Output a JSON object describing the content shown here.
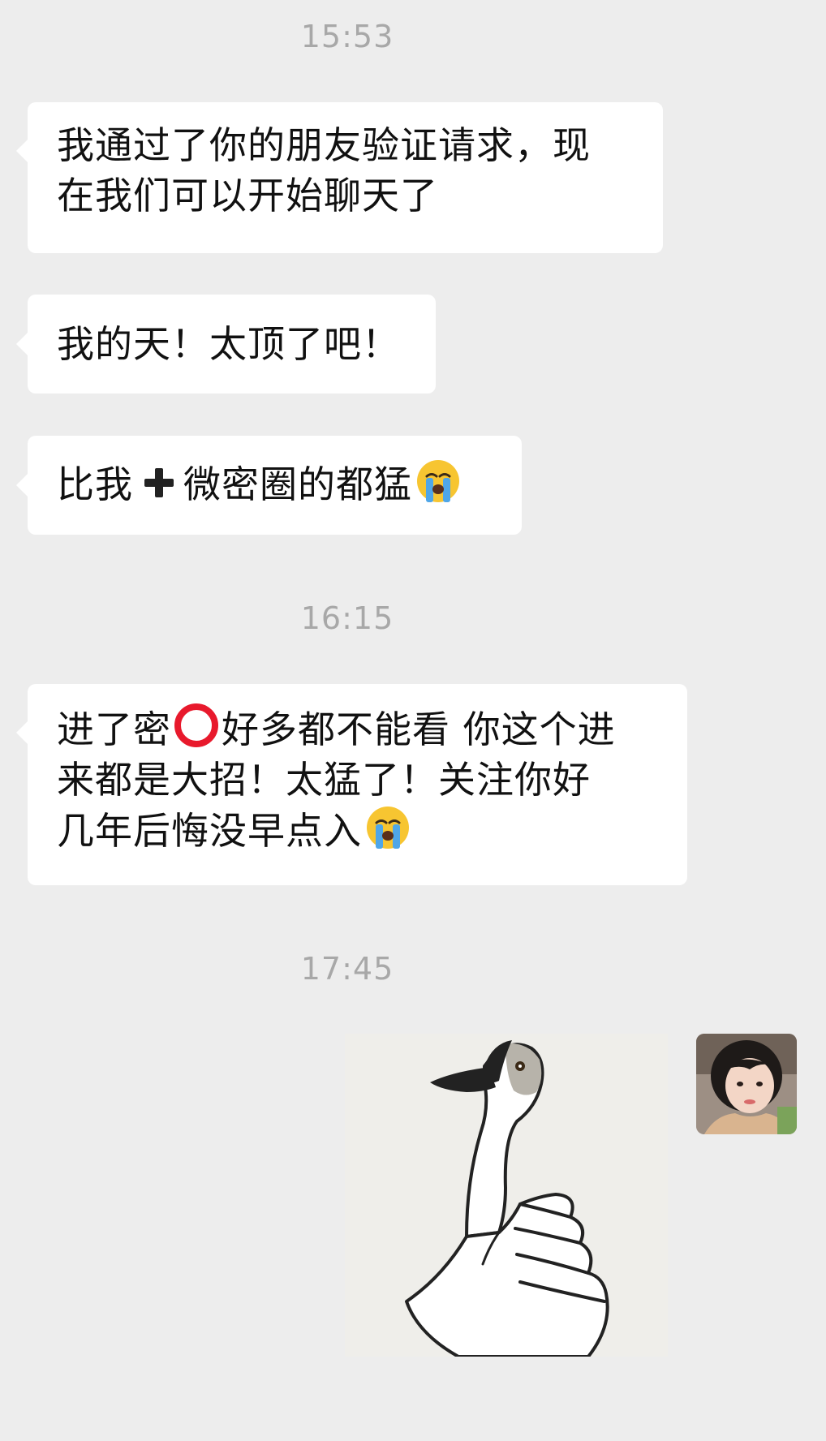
{
  "chat": {
    "timestamps": [
      "15:53",
      "16:15",
      "17:45"
    ],
    "messages": {
      "m1": {
        "line1": "我通过了你的朋友验证请求，现",
        "line2": "在我们可以开始聊天了"
      },
      "m2": {
        "text": "我的天！太顶了吧！"
      },
      "m3": {
        "before": "比我",
        "plus_icon": "heavy-plus-icon",
        "after": "微密圈的都猛",
        "emoji": "loudly-crying-face-icon"
      },
      "m4": {
        "line1_a": "进了密",
        "circle_icon": "hollow-red-circle-icon",
        "line1_b": "好多都不能看 你这个进",
        "line2": "来都是大招！太猛了！关注你好",
        "line3": "几年后悔没早点入",
        "emoji": "loudly-crying-face-icon"
      },
      "m5": {
        "sticker": "goose-thumbs-up-sticker"
      }
    }
  },
  "colors": {
    "background": "#ededed",
    "bubble": "#ffffff",
    "timestamp_text": "#a8a8a8",
    "message_text": "#111111",
    "circle_red": "#e8192c"
  }
}
